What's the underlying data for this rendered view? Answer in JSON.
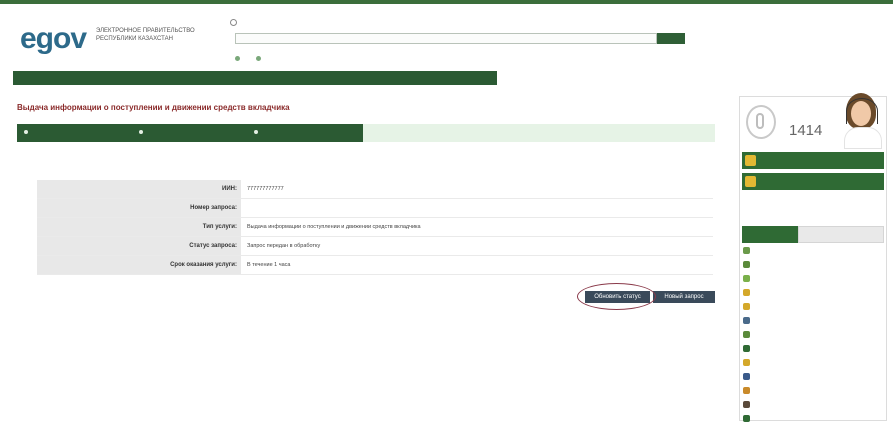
{
  "header": {
    "logo_text": "egov",
    "logo_subtitle": "ЭЛЕКТРОННОЕ ПРАВИТЕЛЬСТВО РЕСПУБЛИКИ КАЗАХСТАН",
    "top_links": [
      "",
      "",
      ""
    ],
    "languages": [
      "",
      "",
      ""
    ],
    "search": {
      "value": "",
      "placeholder": "",
      "button_label": "",
      "hint": "",
      "radio_options": [
        "",
        ""
      ]
    }
  },
  "nav": {
    "items": [
      "",
      "",
      "",
      ""
    ]
  },
  "page": {
    "title": "Выдача информации о поступлении и движении средств вкладчика",
    "steps": [
      {
        "step": "",
        "name": ""
      },
      {
        "step": "",
        "name": ""
      },
      {
        "step": "",
        "name": ""
      }
    ]
  },
  "info": {
    "rows": [
      {
        "label": "ИИН:",
        "value": "777777777777"
      },
      {
        "label": "Номер запроса:",
        "value": ""
      },
      {
        "label": "Тип услуги:",
        "value": "Выдача информации о поступлении и движении средств вкладчика"
      },
      {
        "label": "Статус запроса:",
        "value": "Запрос передан в обработку"
      },
      {
        "label": "Срок оказания услуги:",
        "value": "В течение 1 часа"
      }
    ]
  },
  "actions": {
    "refresh_label": "Обновить статус",
    "new_request_label": "Новый запрос"
  },
  "sidebar": {
    "callcenter_label": "",
    "callcenter_phone": "",
    "callcenter_number": "1414",
    "green_boxes": [
      "",
      ""
    ],
    "tabs": [
      "",
      ""
    ],
    "items": [
      {
        "label": "",
        "icon": "user-icon",
        "color": "#6a9a4a"
      },
      {
        "label": "",
        "icon": "dollar-icon",
        "color": "#5a8a3a"
      },
      {
        "label": "",
        "icon": "history-icon",
        "color": "#7ab04a"
      },
      {
        "label": "",
        "icon": "coin-icon",
        "color": "#d4a82a"
      },
      {
        "label": "",
        "icon": "coin-icon",
        "color": "#d4a82a"
      },
      {
        "label": "",
        "icon": "car-icon",
        "color": "#4a6a8a"
      },
      {
        "label": "",
        "icon": "dollar-icon",
        "color": "#5a8a3a"
      },
      {
        "label": "",
        "icon": "bell-icon",
        "color": "#2f6a34"
      },
      {
        "label": "",
        "icon": "pencil-icon",
        "color": "#d4a82a"
      },
      {
        "label": "",
        "icon": "mail-icon",
        "color": "#3a5a8a"
      },
      {
        "label": "",
        "icon": "bag-icon",
        "color": "#c98a2a"
      },
      {
        "label": "",
        "icon": "briefcase-icon",
        "color": "#5a4a3a"
      },
      {
        "label": "",
        "icon": "check-icon",
        "color": "#2f6a34"
      }
    ]
  },
  "colors": {
    "brand_green": "#2b5a33",
    "title_red": "#8a2a2a",
    "link_blue": "#4a6d9a",
    "button_dark": "#3a4a5a",
    "annotation_circle": "#8a3a4a"
  }
}
